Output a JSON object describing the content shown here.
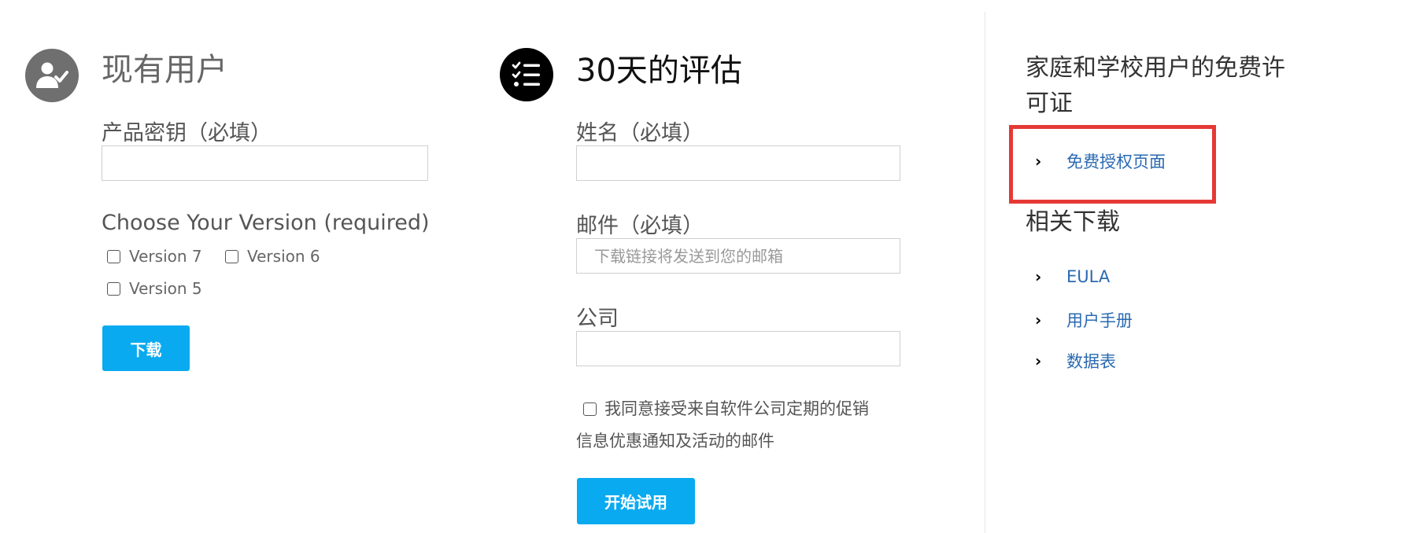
{
  "existing_users": {
    "title": "现有用户",
    "product_key_label": "产品密钥（必填）",
    "product_key_value": "",
    "version_label": "Choose Your Version (required)",
    "versions": [
      "Version 7",
      "Version 6",
      "Version 5"
    ],
    "download_button": "下载"
  },
  "evaluation": {
    "title": "30天的评估",
    "name_label": "姓名（必填）",
    "name_value": "",
    "email_label": "邮件（必填）",
    "email_placeholder": "下载链接将发送到您的邮箱",
    "company_label": "公司",
    "company_value": "",
    "consent_line1": "我同意接受来自软件公司定期的促销",
    "consent_line2": "信息优惠通知及活动的邮件",
    "start_button": "开始试用"
  },
  "sidebar": {
    "free_license_title_line1": "家庭和学校用户的免费许",
    "free_license_title_line2": "可证",
    "free_license_link": "免费授权页面",
    "related_title": "相关下载",
    "related_links": [
      "EULA",
      "用户手册",
      "数据表"
    ]
  },
  "icons": {
    "existing_user": "user-check-icon",
    "evaluation": "checklist-icon",
    "chevron": "chevron-right-icon"
  },
  "colors": {
    "accent_button": "#0aaaf0",
    "link": "#2a6ab2",
    "highlight": "#e53935"
  }
}
